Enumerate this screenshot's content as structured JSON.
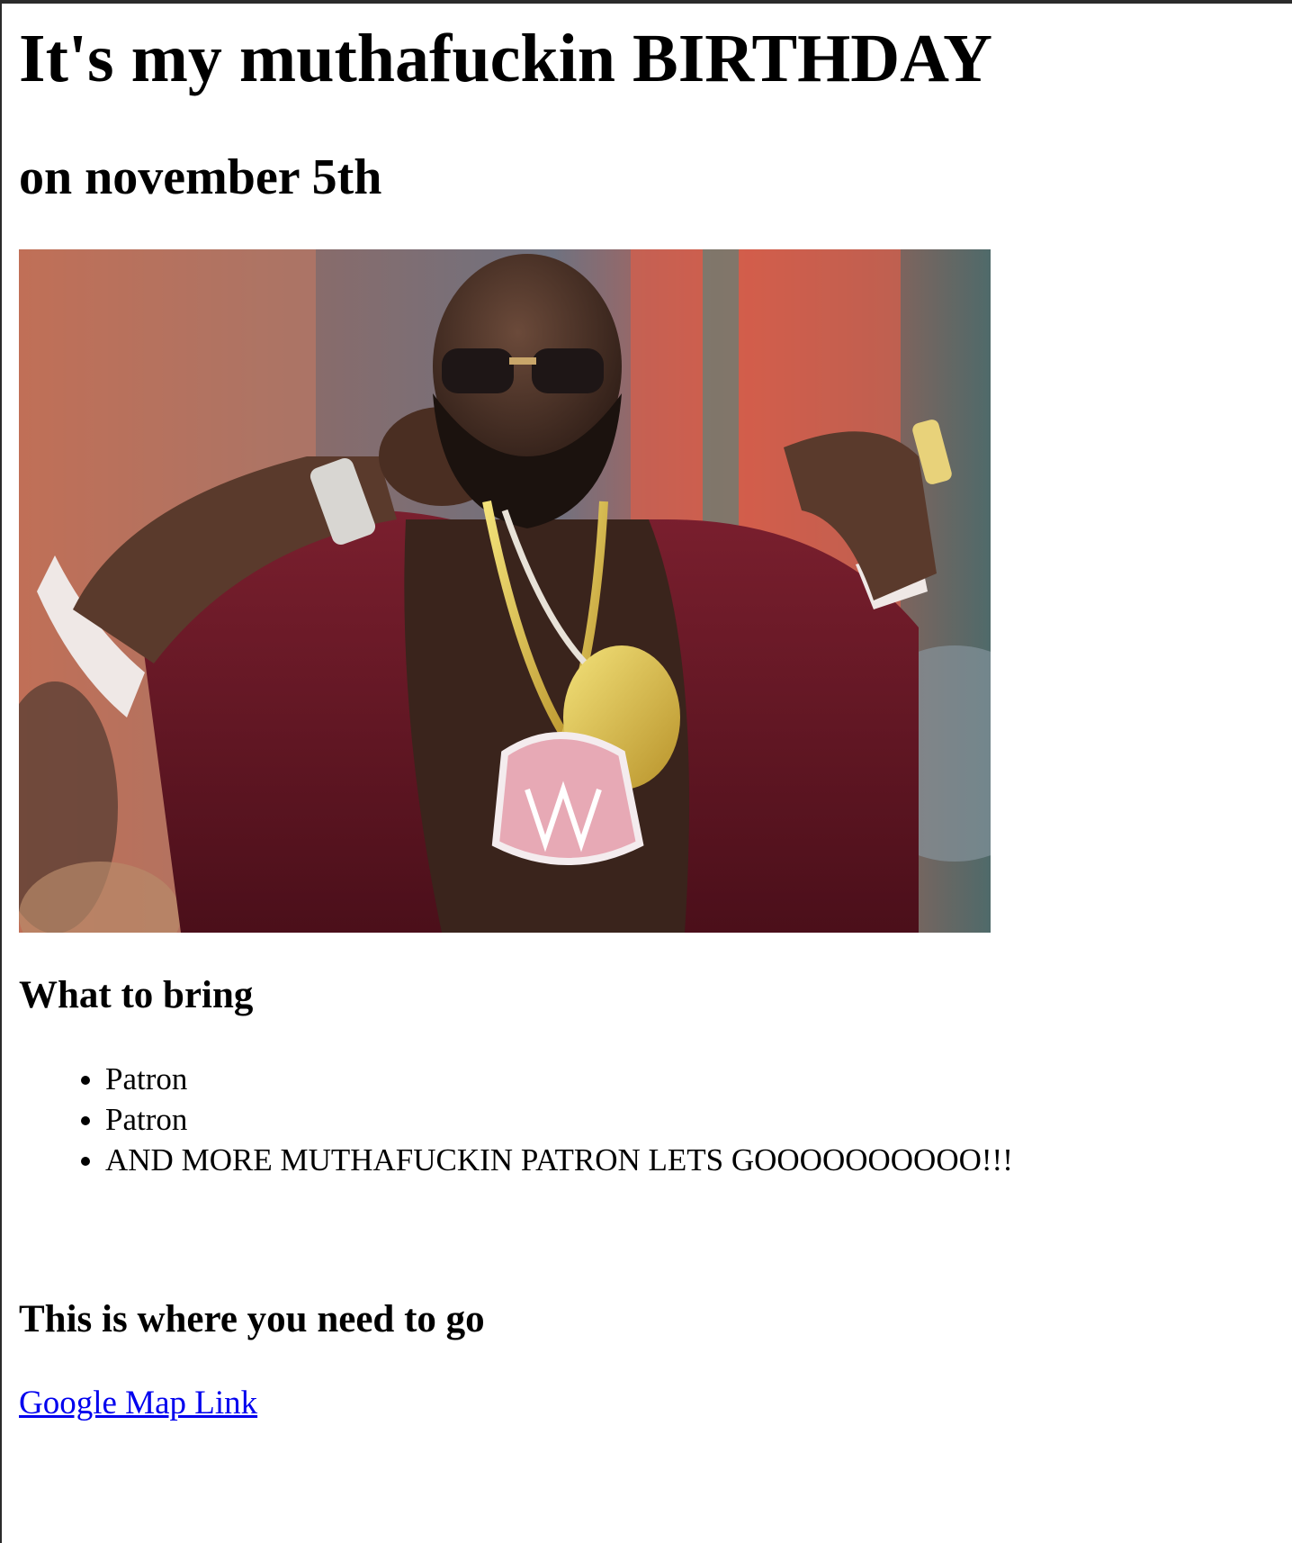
{
  "page": {
    "title": "It's my muthafuckin BIRTHDAY",
    "subtitle": "on november 5th"
  },
  "photo": {
    "alt": "Rapper performing on stage with microphone, sunglasses, maroon jacket and gold chains"
  },
  "bring": {
    "heading": "What to bring",
    "items": [
      "Patron",
      "Patron",
      "AND MORE MUTHAFUCKIN PATRON LETS GOOOOOOOOOO!!!"
    ]
  },
  "location": {
    "heading": "This is where you need to go",
    "link_label": "Google Map Link"
  },
  "colors": {
    "link": "#0000ee",
    "text": "#000000",
    "background": "#ffffff"
  }
}
